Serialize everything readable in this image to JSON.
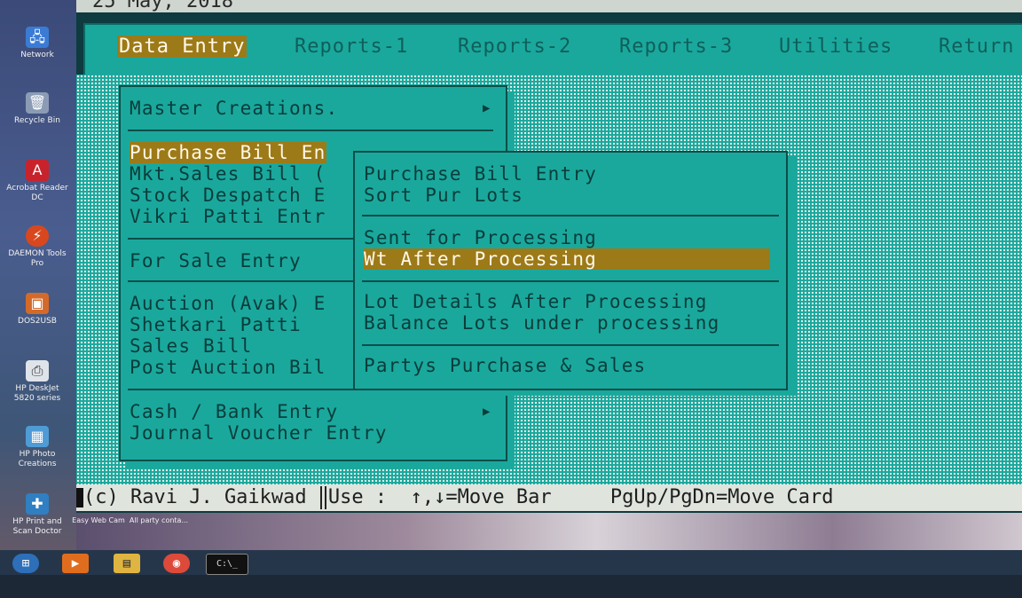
{
  "desktop": {
    "icons": [
      {
        "label": "Network",
        "icon": "network-icon"
      },
      {
        "label": "Recycle Bin",
        "icon": "recycle-bin-icon"
      },
      {
        "label": "Acrobat Reader DC",
        "icon": "acrobat-icon"
      },
      {
        "label": "DAEMON Tools Pro",
        "icon": "daemon-tools-icon"
      },
      {
        "label": "DOS2USB",
        "icon": "dos2usb-icon"
      },
      {
        "label": "HP DeskJet 5820 series",
        "icon": "printer-icon"
      },
      {
        "label": "HP Photo Creations",
        "icon": "photo-icon"
      },
      {
        "label": "HP Print and Scan Doctor",
        "icon": "scan-icon"
      }
    ],
    "bottom_icons": [
      {
        "label": "Easy Web Cam",
        "icon": "webcam-icon"
      },
      {
        "label": "All party conta...",
        "icon": "document-icon"
      }
    ]
  },
  "console": {
    "date": "25 May, 2018",
    "menu_bar": [
      {
        "label": "Data Entry",
        "active": true
      },
      {
        "label": "Reports-1",
        "active": false
      },
      {
        "label": "Reports-2",
        "active": false
      },
      {
        "label": "Reports-3",
        "active": false
      },
      {
        "label": "Utilities",
        "active": false
      },
      {
        "label": "Return",
        "active": false
      }
    ],
    "main_menu": {
      "items": [
        "Master Creations.",
        "Purchase Bill En",
        "Mkt.Sales Bill (",
        "Stock Despatch E",
        "Vikri Patti Entr",
        "For Sale Entry",
        "Auction (Avak) E",
        "Shetkari Patti",
        "Sales Bill",
        "Post Auction Bil",
        "Cash / Bank Entry",
        "Journal Voucher Entry"
      ],
      "arrow": "▶"
    },
    "sub_menu": {
      "items": [
        "Purchase Bill Entry",
        "Sort Pur Lots",
        "Sent for Processing",
        "Wt After Processing",
        "Lot Details After Processing",
        "Balance Lots under processing",
        "Partys Purchase & Sales"
      ]
    },
    "status_bar": {
      "copyright": "(c) Ravi J. Gaikwad",
      "use_label": "Use :",
      "move_bar": "↑,↓=Move Bar",
      "move_card": "PgUp/PgDn=Move Card"
    }
  },
  "colors": {
    "teal": "#1aa89d",
    "highlight": "#9c7a18",
    "dark_text": "#0a3d3a"
  }
}
